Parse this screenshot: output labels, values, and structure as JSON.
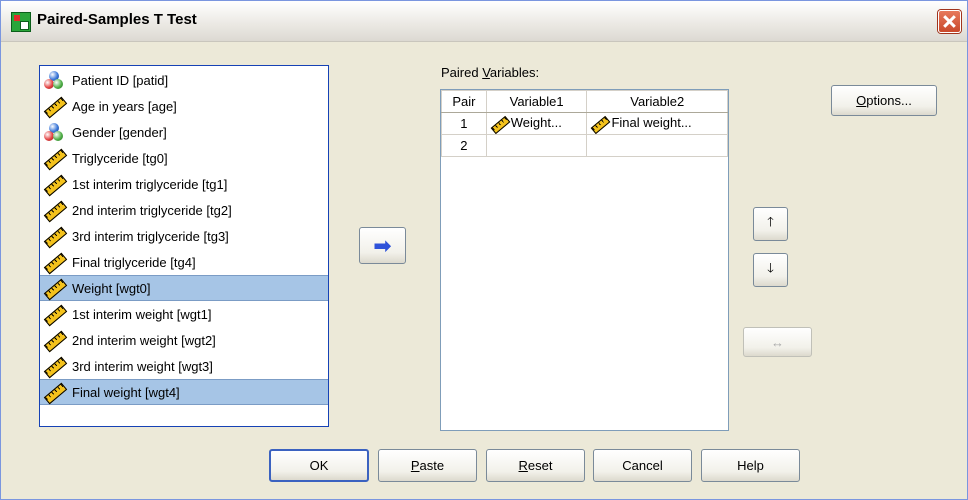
{
  "window": {
    "title": "Paired-Samples T Test"
  },
  "source_variables": [
    {
      "label": "Patient ID [patid]",
      "icon": "nominal-icon",
      "selected": false
    },
    {
      "label": "Age in years [age]",
      "icon": "scale-icon",
      "selected": false
    },
    {
      "label": "Gender [gender]",
      "icon": "nominal-icon",
      "selected": false
    },
    {
      "label": "Triglyceride [tg0]",
      "icon": "scale-icon",
      "selected": false
    },
    {
      "label": "1st interim triglyceride [tg1]",
      "icon": "scale-icon",
      "selected": false
    },
    {
      "label": "2nd interim triglyceride [tg2]",
      "icon": "scale-icon",
      "selected": false
    },
    {
      "label": "3rd interim triglyceride [tg3]",
      "icon": "scale-icon",
      "selected": false
    },
    {
      "label": "Final triglyceride [tg4]",
      "icon": "scale-icon",
      "selected": false
    },
    {
      "label": "Weight [wgt0]",
      "icon": "scale-icon",
      "selected": true
    },
    {
      "label": "1st interim weight [wgt1]",
      "icon": "scale-icon",
      "selected": false
    },
    {
      "label": "2nd interim weight [wgt2]",
      "icon": "scale-icon",
      "selected": false
    },
    {
      "label": "3rd interim weight [wgt3]",
      "icon": "scale-icon",
      "selected": false
    },
    {
      "label": "Final weight [wgt4]",
      "icon": "scale-icon",
      "selected": true
    }
  ],
  "paired": {
    "label_prefix": "Paired ",
    "label_accel": "V",
    "label_suffix": "ariables:",
    "columns": [
      "Pair",
      "Variable1",
      "Variable2"
    ],
    "rows": [
      {
        "pair": "1",
        "var1": "Weight...",
        "var2": "Final weight..."
      },
      {
        "pair": "2",
        "var1": "",
        "var2": ""
      }
    ]
  },
  "buttons": {
    "options_accel": "O",
    "options_rest": "ptions...",
    "ok": "OK",
    "paste_accel": "P",
    "paste_rest": "aste",
    "reset_accel": "R",
    "reset_rest": "eset",
    "cancel": "Cancel",
    "help": "Help",
    "move_glyph": "➡",
    "up_glyph": "🡑",
    "down_glyph": "🡓",
    "swap_glyph": "↔"
  },
  "colors": {
    "selection": "#a6c5e6",
    "list_border": "#1642b5",
    "arrow_blue": "#2f53d9"
  }
}
